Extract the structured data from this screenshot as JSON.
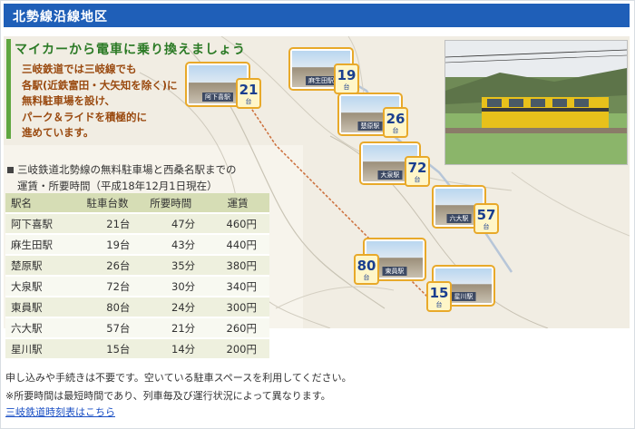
{
  "header": {
    "title": "北勢線沿線地区"
  },
  "banner": {
    "catch_title": "マイカーから電車に乗り換えましょう",
    "catch_lines": [
      "三岐鉄道では三岐線でも",
      "各駅(近鉄富田・大矢知を除く)に",
      "無料駐車場を設け、",
      "パーク＆ライドを積極的に",
      "進めています。"
    ],
    "map_cards": [
      {
        "label": "阿下喜駅",
        "count": "21",
        "unit": "台"
      },
      {
        "label": "麻生田駅",
        "count": "19",
        "unit": "台"
      },
      {
        "label": "楚原駅",
        "count": "26",
        "unit": "台"
      },
      {
        "label": "大泉駅",
        "count": "72",
        "unit": "台"
      },
      {
        "label": "六大駅",
        "count": "57",
        "unit": "台"
      },
      {
        "label": "東員駅",
        "count": "80",
        "unit": "台"
      },
      {
        "label": "星川駅",
        "count": "15",
        "unit": "台"
      }
    ]
  },
  "fare_section": {
    "heading_line1": "三岐鉄道北勢線の無料駐車場と西桑名駅までの",
    "heading_line2": "運賃・所要時間（平成18年12月1日現在）"
  },
  "table": {
    "headers": [
      "駅名",
      "駐車台数",
      "所要時間",
      "運賃"
    ],
    "rows": [
      {
        "station": "阿下喜駅",
        "spaces": "21台",
        "time": "47分",
        "fare": "460円"
      },
      {
        "station": "麻生田駅",
        "spaces": "19台",
        "time": "43分",
        "fare": "440円"
      },
      {
        "station": "楚原駅",
        "spaces": "26台",
        "time": "35分",
        "fare": "380円"
      },
      {
        "station": "大泉駅",
        "spaces": "72台",
        "time": "30分",
        "fare": "340円"
      },
      {
        "station": "東員駅",
        "spaces": "80台",
        "time": "24分",
        "fare": "300円"
      },
      {
        "station": "六大駅",
        "spaces": "57台",
        "time": "21分",
        "fare": "260円"
      },
      {
        "station": "星川駅",
        "spaces": "15台",
        "time": "14分",
        "fare": "200円"
      }
    ]
  },
  "notes": {
    "line1": "申し込みや手続きは不要です。空いている駐車スペースを利用してください。",
    "line2": "※所要時間は最短時間であり、列車毎及び運行状況によって異なります。"
  },
  "link": {
    "text": "三岐鉄道時刻表はこちら"
  }
}
